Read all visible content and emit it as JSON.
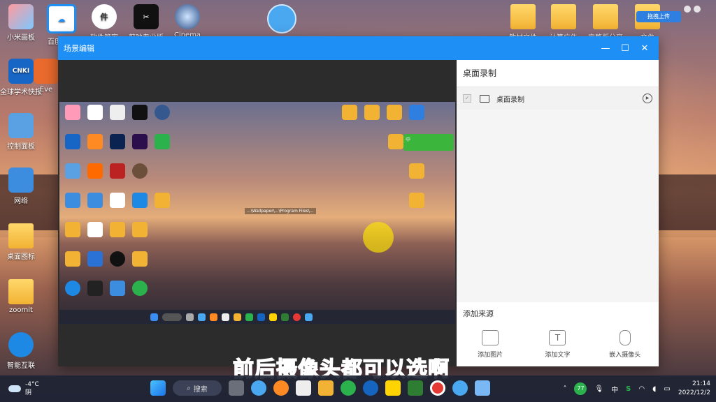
{
  "desktop": {
    "left_icons": [
      {
        "label": "小米画板"
      },
      {
        "label": "百度网盘"
      },
      {
        "label": "软件管家"
      },
      {
        "label": "剪映专业版"
      },
      {
        "label": "Cinema"
      },
      {
        "label": "全球学术快报"
      },
      {
        "label": "Eve"
      },
      {
        "label": "控制面板"
      },
      {
        "label": "网络"
      },
      {
        "label": "桌面图标"
      },
      {
        "label": "zoomit"
      },
      {
        "label": "智能互联"
      }
    ],
    "left_badges": {
      "cnki": "CNKI"
    },
    "right_icons": [
      {
        "label": "教材文件"
      },
      {
        "label": "计算广告"
      },
      {
        "label": "完整版分享"
      },
      {
        "label": "文件"
      }
    ],
    "right_badge": "拖拽上传"
  },
  "window": {
    "title": "场景编辑",
    "min": "—",
    "max": "☐",
    "close": "✕"
  },
  "preview": {
    "tooltip": "...\\Wallpaper\\...\\Program Files\\...",
    "popup_label": "中"
  },
  "panel": {
    "title": "桌面录制",
    "source_label": "桌面录制",
    "add_title": "添加来源",
    "add_items": [
      {
        "label": "添加图片",
        "icon": "image-icon"
      },
      {
        "label": "添加文字",
        "icon": "text-icon"
      },
      {
        "label": "嵌入摄像头",
        "icon": "camera-icon"
      }
    ]
  },
  "subtitle": "前后摄像头都可以选啊",
  "taskbar": {
    "weather_temp": "-4°C",
    "weather_text": "阴",
    "search_label": "搜索",
    "tray_badge": "77",
    "ime": "中",
    "time": "21:14",
    "date": "2022/12/2"
  },
  "colors": {
    "titlebar": "#1e8ff5",
    "subtitle": "#ff4fb2"
  }
}
